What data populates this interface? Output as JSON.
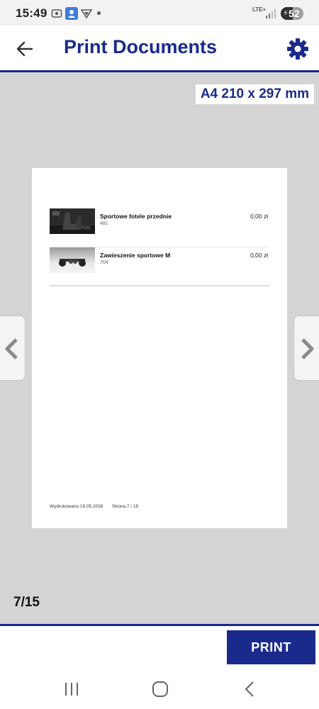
{
  "status_bar": {
    "time": "15:49",
    "network": "LTE+",
    "battery": "52",
    "battery_level": 0.52
  },
  "header": {
    "title": "Print Documents",
    "back_icon": "arrow-left-icon",
    "settings_icon": "gear-icon"
  },
  "preview": {
    "paper_size": "A4 210 x 297 mm",
    "items": [
      {
        "name": "Sportowe fotele przednie",
        "code": "481",
        "price": "0,00 zł"
      },
      {
        "name": "Zawieszenie sportowe M",
        "code": "704",
        "price": "0,00 zł"
      }
    ],
    "footer_printed": "Wydrukowano 19.05.2026",
    "footer_page": "Strona 7 / 15",
    "page_counter": "7/15"
  },
  "actions": {
    "print_label": "PRINT"
  },
  "colors": {
    "brand": "#1a2a8c",
    "preview_bg": "#d4d4d4"
  }
}
